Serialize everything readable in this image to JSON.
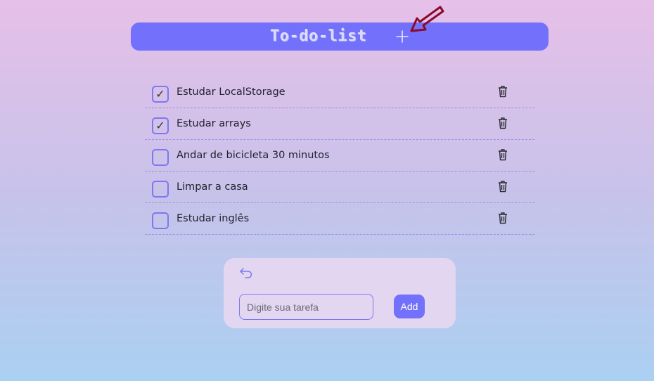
{
  "header": {
    "title": "To-do-list",
    "add_icon": "plus-icon"
  },
  "todos": [
    {
      "label": "Estudar LocalStorage",
      "checked": true,
      "mark": "✓"
    },
    {
      "label": "Estudar arrays",
      "checked": true,
      "mark": "✓"
    },
    {
      "label": "Andar de bicicleta 30 minutos",
      "checked": false,
      "mark": ""
    },
    {
      "label": "Limpar a casa",
      "checked": false,
      "mark": ""
    },
    {
      "label": "Estudar inglês",
      "checked": false,
      "mark": ""
    }
  ],
  "form": {
    "back_icon": "undo-arrow-icon",
    "placeholder": "Digite sua tarefa",
    "value": "",
    "add_label": "Add"
  },
  "colors": {
    "accent": "#7370fb",
    "annotation_arrow": "#8b0a2a"
  }
}
